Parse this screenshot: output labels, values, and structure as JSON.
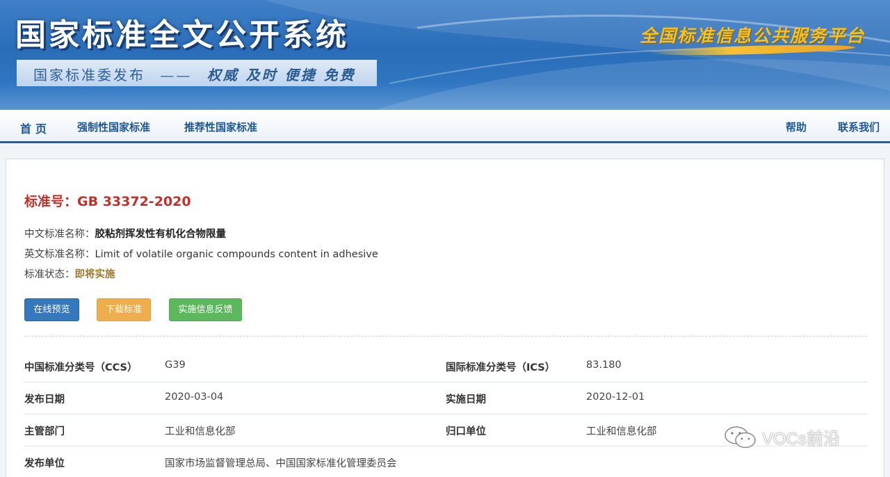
{
  "banner": {
    "title": "国家标准全文公开系统",
    "slogan_left": "国家标准委发布",
    "slogan_dash": "——",
    "slogan_right": "权威 及时 便捷 免费",
    "platform": "全国标准信息公共服务平台"
  },
  "nav": {
    "home": "首页",
    "mandatory": "强制性国家标准",
    "recommended": "推荐性国家标准",
    "help": "帮助",
    "contact": "联系我们"
  },
  "standard": {
    "number_label": "标准号：",
    "number": "GB 33372-2020",
    "cn_name_label": "中文标准名称：",
    "cn_name": "胶粘剂挥发性有机化合物限量",
    "en_name_label": "英文标准名称：",
    "en_name": "Limit of volatile organic compounds content in adhesive",
    "status_label": "标准状态：",
    "status": "即将实施"
  },
  "buttons": {
    "preview": "在线预览",
    "download": "下载标准",
    "feedback": "实施信息反馈"
  },
  "details": [
    {
      "label1": "中国标准分类号（CCS）",
      "value1": "G39",
      "label2": "国际标准分类号（ICS）",
      "value2": "83.180"
    },
    {
      "label1": "发布日期",
      "value1": "2020-03-04",
      "label2": "实施日期",
      "value2": "2020-12-01"
    },
    {
      "label1": "主管部门",
      "value1": "工业和信息化部",
      "label2": "归口单位",
      "value2": "工业和信息化部"
    },
    {
      "label1": "发布单位",
      "value1": "国家市场监督管理总局、中国国家标准化管理委员会",
      "label2": "",
      "value2": ""
    }
  ],
  "watermark": {
    "text": "VOCs前沿",
    "icon": "wechat-icon"
  },
  "colors": {
    "brand_blue": "#1e5796",
    "std_number_red": "#c0312b",
    "status_gold": "#a07a2e",
    "btn_preview": "#3578bd",
    "btn_download": "#f0ad4e",
    "btn_feedback": "#5cb85c"
  }
}
